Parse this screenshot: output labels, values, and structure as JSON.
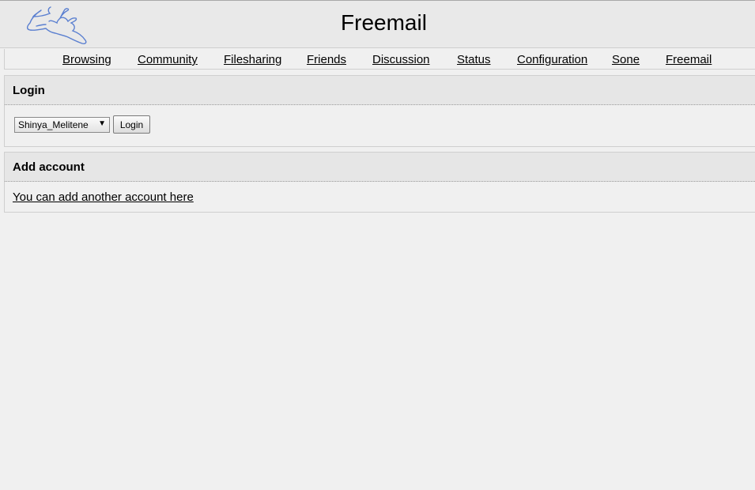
{
  "header": {
    "title": "Freemail",
    "logo_icon": "rabbit-logo-icon"
  },
  "nav": {
    "items": [
      {
        "label": "Browsing"
      },
      {
        "label": "Community"
      },
      {
        "label": "Filesharing"
      },
      {
        "label": "Friends"
      },
      {
        "label": "Discussion"
      },
      {
        "label": "Status"
      },
      {
        "label": "Configuration"
      },
      {
        "label": "Sone"
      },
      {
        "label": "Freemail"
      }
    ]
  },
  "login": {
    "heading": "Login",
    "account_select_value": "Shinya_Melitene",
    "button_label": "Login"
  },
  "add_account": {
    "heading": "Add account",
    "link_text": "You can add another account here"
  },
  "colors": {
    "logo_stroke": "#5a7fd0",
    "background": "#f0f0f0",
    "header_bg": "#e9e9e9"
  }
}
